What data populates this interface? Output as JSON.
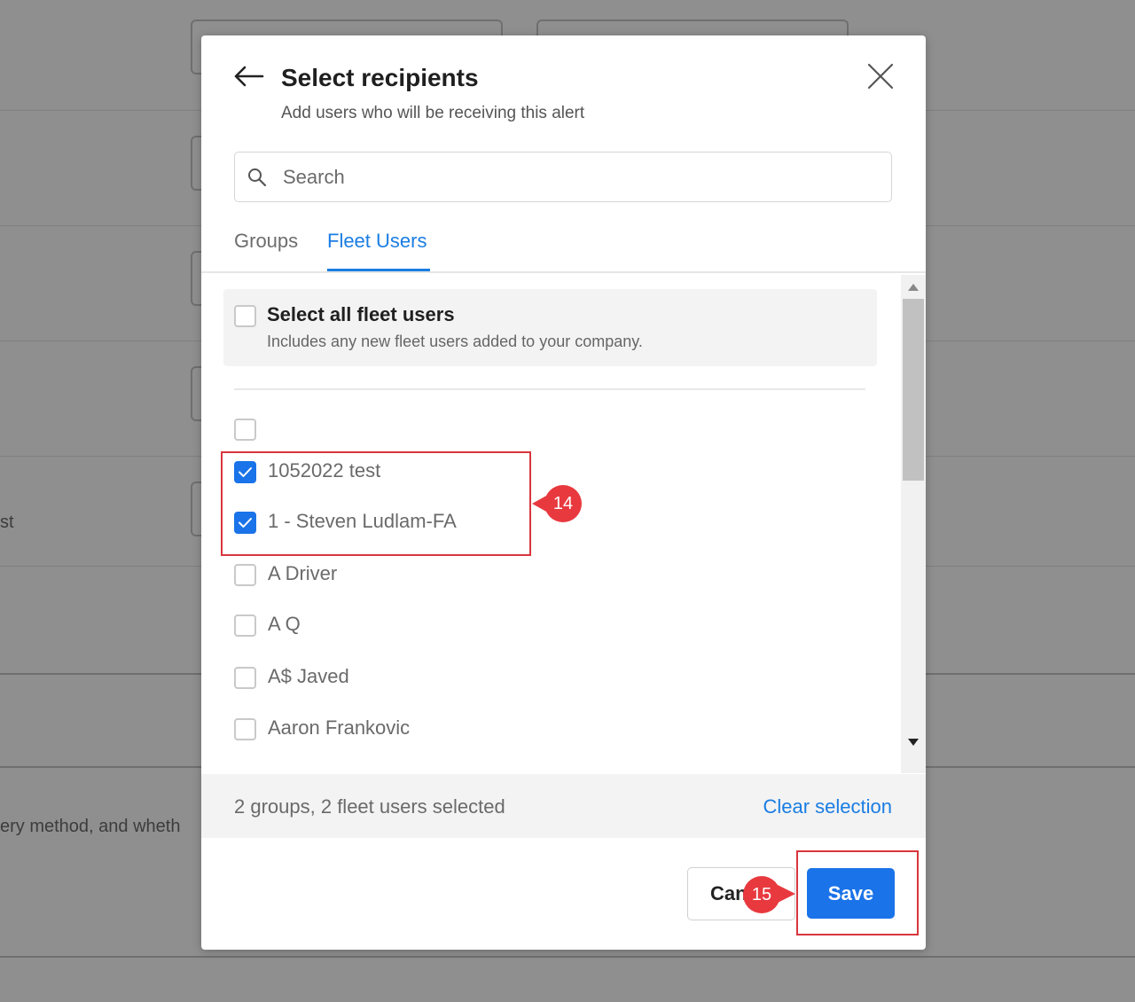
{
  "background": {
    "partial_text_1": "st",
    "partial_text_2": "ery method, and wheth"
  },
  "modal": {
    "title": "Select recipients",
    "subtitle": "Add users who will be receiving this alert",
    "search": {
      "placeholder": "Search",
      "value": ""
    },
    "tabs": [
      {
        "label": "Groups",
        "active": false
      },
      {
        "label": "Fleet Users",
        "active": true
      }
    ],
    "select_all": {
      "title": "Select all fleet users",
      "description": "Includes any new fleet users added to your company.",
      "checked": false
    },
    "users": [
      {
        "name": "",
        "checked": false
      },
      {
        "name": "1052022 test",
        "checked": true
      },
      {
        "name": "1 - Steven Ludlam-FA",
        "checked": true
      },
      {
        "name": "A Driver",
        "checked": false
      },
      {
        "name": "A Q",
        "checked": false
      },
      {
        "name": "A$ Javed",
        "checked": false
      },
      {
        "name": "Aaron Frankovic",
        "checked": false
      }
    ],
    "footer": {
      "selection_summary": "2 groups, 2 fleet users selected",
      "clear_label": "Clear selection"
    },
    "buttons": {
      "cancel_label": "Cancel",
      "save_label": "Save"
    }
  },
  "annotations": {
    "step_14": "14",
    "step_15": "15"
  },
  "colors": {
    "accent": "#1a73e8",
    "link": "#1a7de3",
    "annotation": "#e8393f",
    "overlay": "#8f8f8f"
  }
}
